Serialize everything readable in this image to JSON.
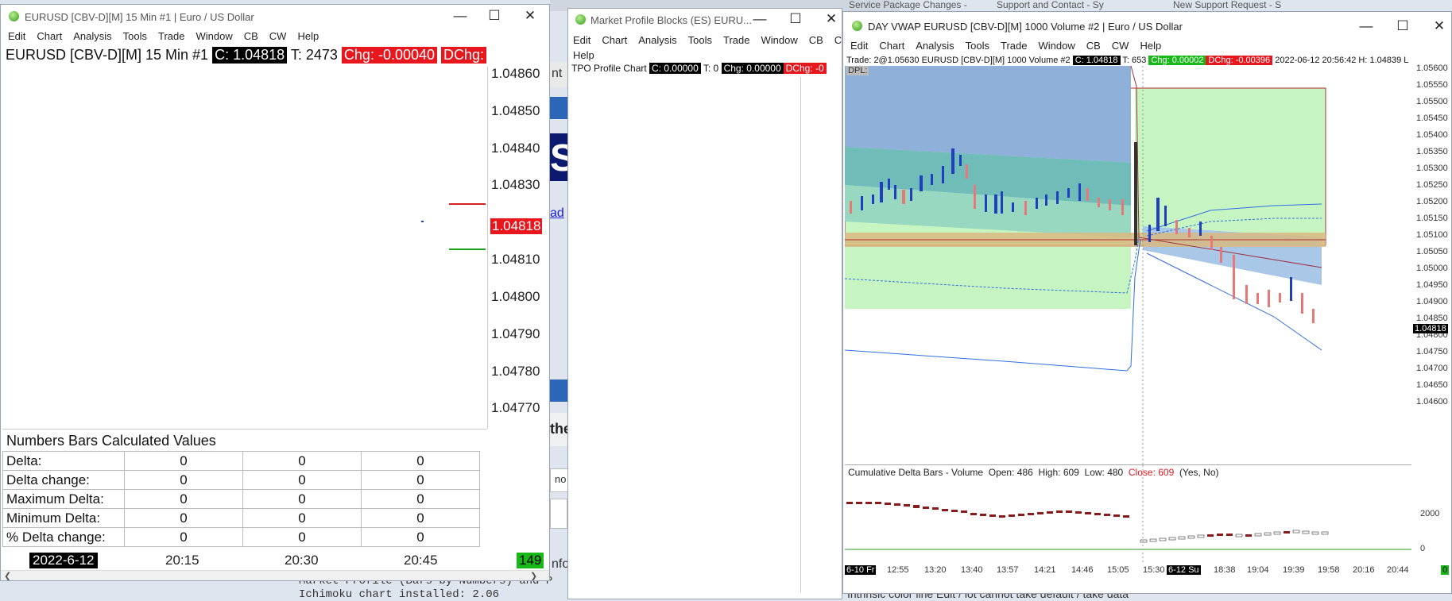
{
  "colors": {
    "up_candle": "#1f3fbf",
    "down_candle": "#e87878",
    "price_badge": "#e8171d",
    "plus_badge": "#18b818"
  },
  "taskbar_tabs": [
    "Service Package Changes -",
    "Support and Contact - Sy",
    "New Support Request - S"
  ],
  "background": {
    "labels": [
      "nt",
      "S",
      "ad",
      "the",
      "no",
      "nfor"
    ],
    "code_line1": "Market Profile (Bars by Numbers) and P",
    "code_line2": "Ichimoku chart installed: 2.06",
    "code_right": "Intrinsic color line  Edit / lot cannot take default / take data"
  },
  "win1": {
    "title": "EURUSD [CBV-D][M]  15 Min  #1 | Euro / US Dollar",
    "menu": [
      "Edit",
      "Chart",
      "Analysis",
      "Tools",
      "Trade",
      "Window",
      "CB",
      "CW",
      "Help"
    ],
    "symbol": "EURUSD [CBV-D][M]  15 Min   #1",
    "close": "C: 1.04818",
    "ticks": "T: 2473",
    "chg": "Chg: -0.00040",
    "dchg": "DChg:",
    "price_axis": [
      "1.04860",
      "1.04850",
      "1.04840",
      "1.04830",
      "1.04818",
      "1.04810",
      "1.04800",
      "1.04790",
      "1.04780",
      "1.04770"
    ],
    "current_price": "1.04818",
    "table_title": "Numbers Bars Calculated Values",
    "rows": [
      {
        "label": "Delta:",
        "values": [
          "0",
          "0",
          "0"
        ]
      },
      {
        "label": "Delta change:",
        "values": [
          "0",
          "0",
          "0"
        ]
      },
      {
        "label": "Maximum Delta:",
        "values": [
          "0",
          "0",
          "0"
        ]
      },
      {
        "label": "Minimum Delta:",
        "values": [
          "0",
          "0",
          "0"
        ]
      },
      {
        "label": "% Delta change:",
        "values": [
          "0",
          "0",
          "0"
        ]
      }
    ],
    "date": "2022-6-12",
    "times": [
      "20:15",
      "20:30",
      "20:45"
    ],
    "countdown": "149"
  },
  "win2": {
    "title": "Market Profile Blocks (ES) EURU...",
    "menu": [
      "Edit",
      "Chart",
      "Analysis",
      "Tools",
      "Trade",
      "Window",
      "CB",
      "CW"
    ],
    "menu2": "Help",
    "chart_title": "TPO Profile Chart",
    "close": "C: 0.00000",
    "ticks": "T: 0",
    "chg": "Chg: 0.00000",
    "dchg": "DChg: -0"
  },
  "win3": {
    "title": "DAY VWAP EURUSD [CBV-D][M]  1000 Volume  #2 | Euro / US Dollar",
    "menu": [
      "Edit",
      "Chart",
      "Analysis",
      "Tools",
      "Trade",
      "Window",
      "CB",
      "CW",
      "Help"
    ],
    "trade": "Trade: 2@1.05630",
    "symbol": "EURUSD [CBV-D][M]  1000 Volume  #2",
    "close": "C: 1.04818",
    "ticks": "T: 653",
    "chg": "Chg: 0.00002",
    "dchg": "DChg: -0.00396",
    "stamp": "2022-06-12 20:56:42  H: 1.04839 L",
    "dpl": "DPL:",
    "price_axis": [
      "1.05600",
      "1.05550",
      "1.05500",
      "1.05450",
      "1.05400",
      "1.05350",
      "1.05300",
      "1.05250",
      "1.05200",
      "1.05150",
      "1.05100",
      "1.05050",
      "1.05000",
      "1.04950",
      "1.04900",
      "1.04850",
      "1.04800",
      "1.04750",
      "1.04700",
      "1.04650",
      "1.04600"
    ],
    "current_price": "1.04818",
    "cd_title": "Cumulative Delta Bars - Volume",
    "cd_open": "Open: 486",
    "cd_high": "High: 609",
    "cd_low": "Low: 480",
    "cd_close": "Close: 609",
    "cd_flags": "(Yes, No)",
    "cd_axis": [
      "2000",
      "0"
    ],
    "x_axis": [
      "6-10 Fr",
      "12:55",
      "13:20",
      "13:40",
      "13:57",
      "14:21",
      "14:46",
      "15:05",
      "15:30",
      "6-12 Su",
      "18:38",
      "19:04",
      "19:39",
      "19:58",
      "20:16",
      "20:44"
    ],
    "corner": "0"
  }
}
